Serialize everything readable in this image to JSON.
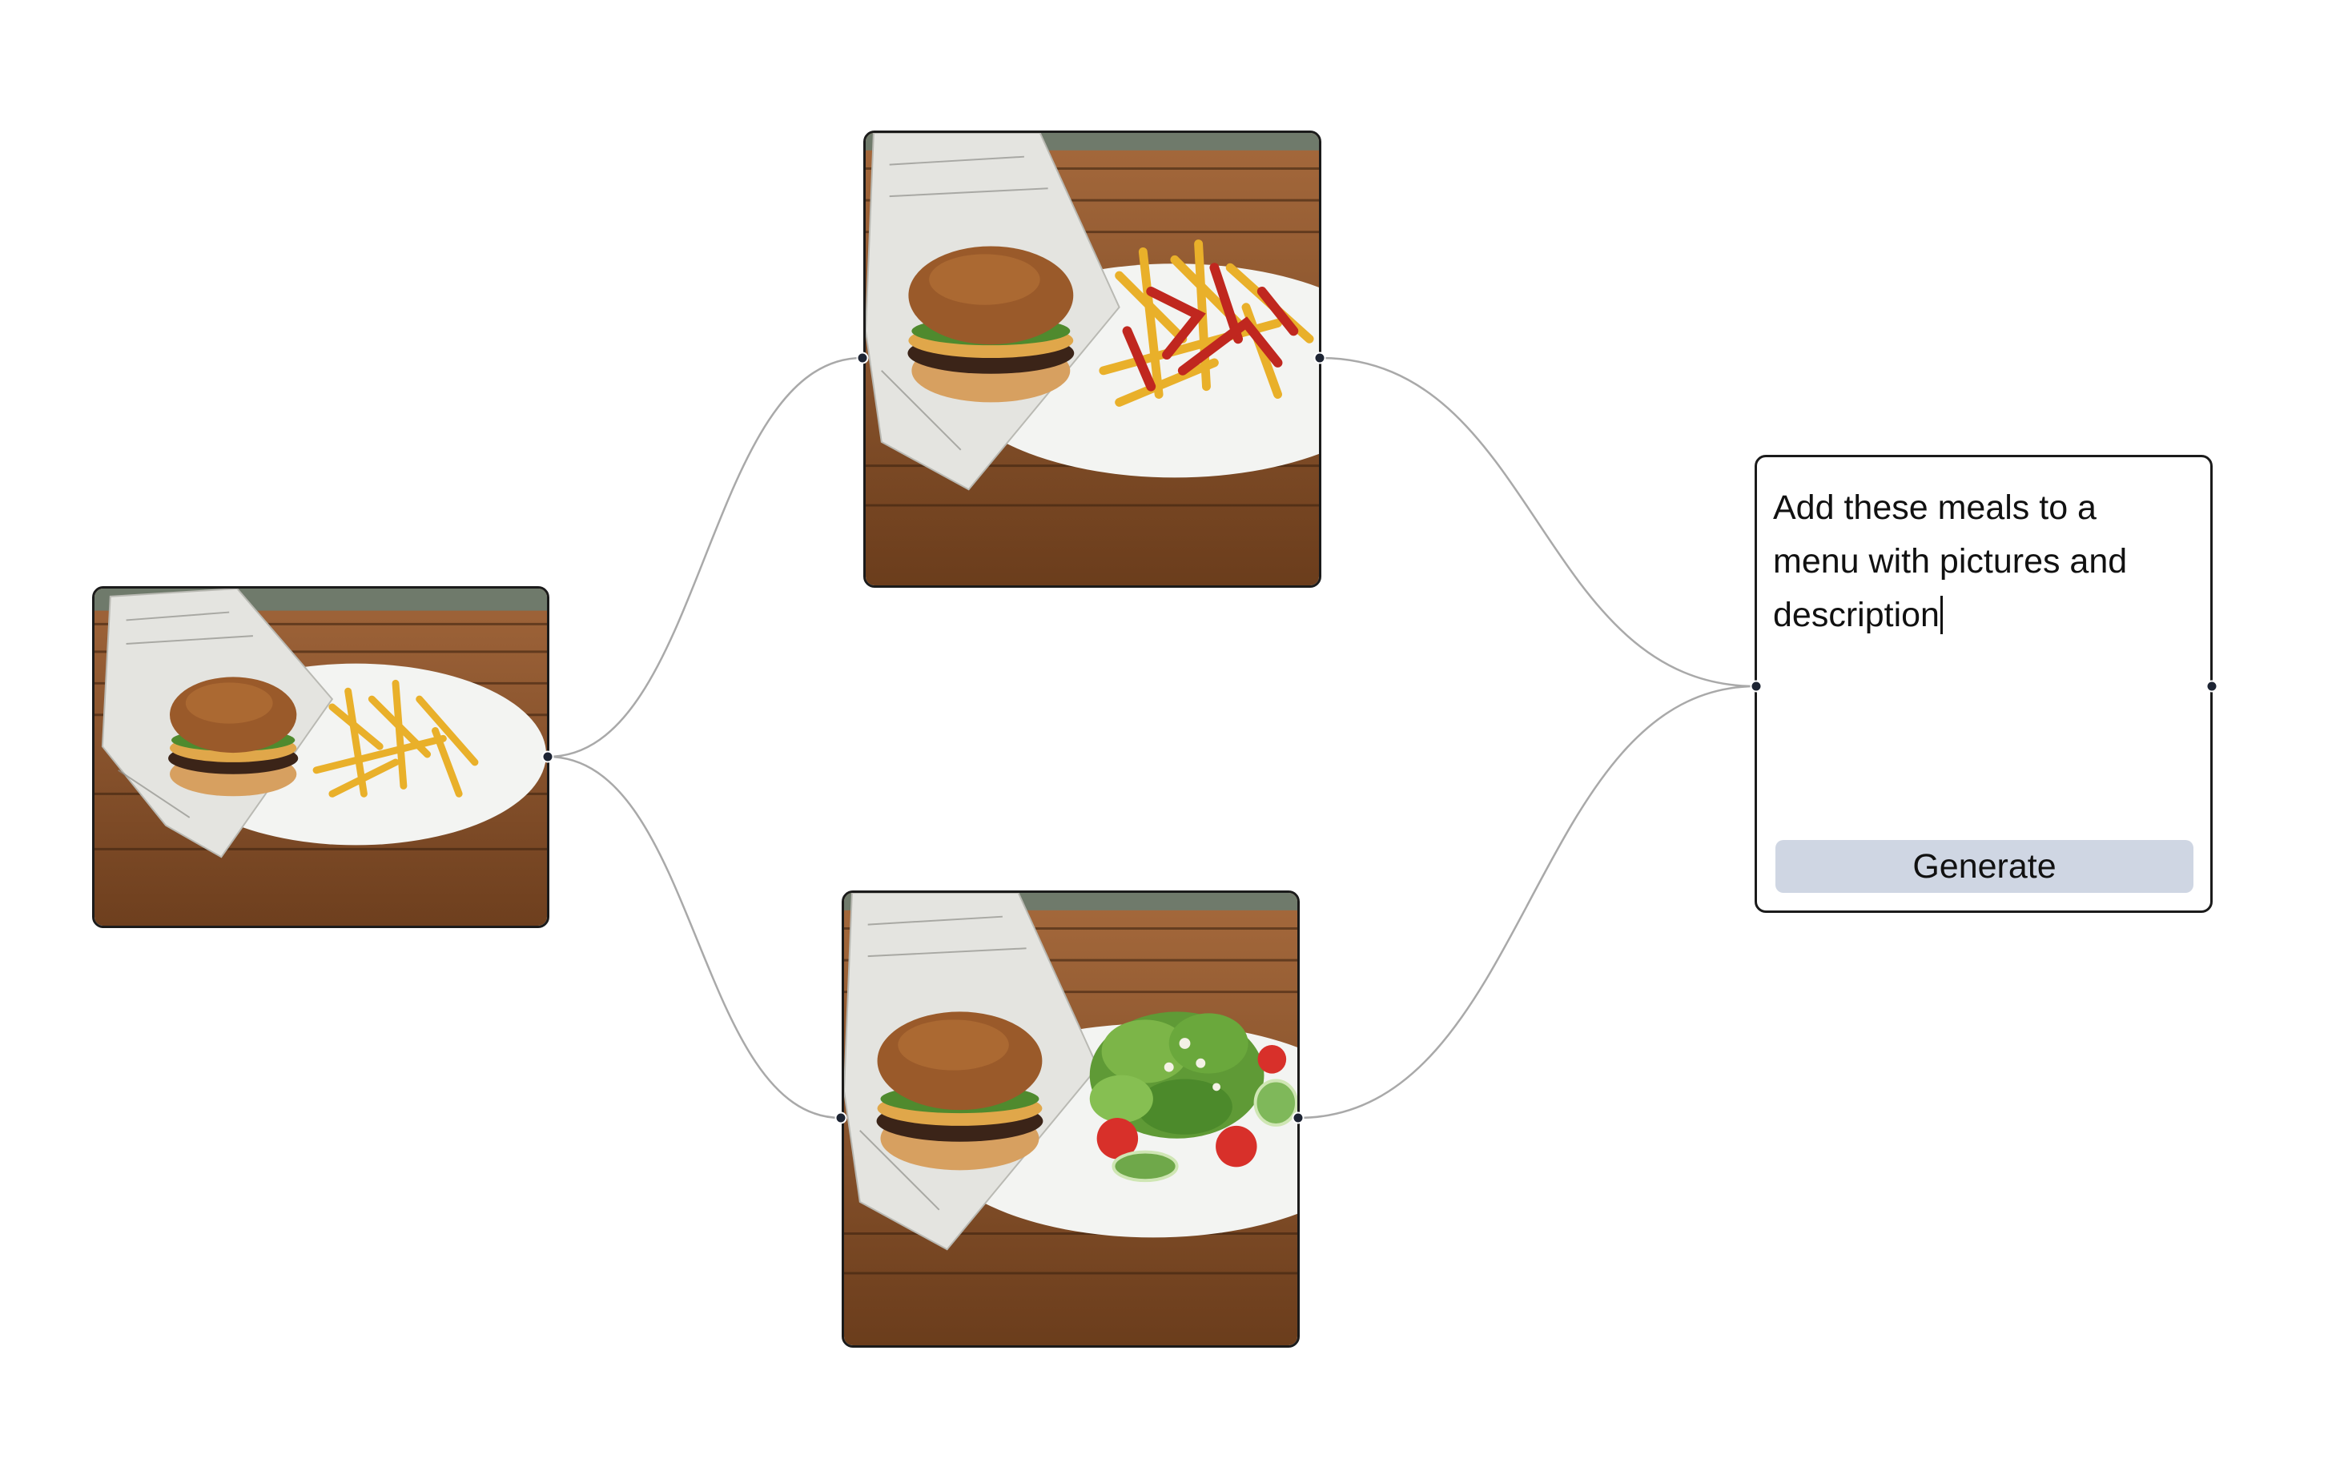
{
  "canvas": {
    "background": "#ffffff",
    "edge_color": "#a9a9a9",
    "handle_color": "#1d2433"
  },
  "image_nodes": [
    {
      "name": "source-image-burger-fries",
      "subject": "burger with fries on plate with newspaper wrap"
    },
    {
      "name": "image-burger-fries-ketchup",
      "subject": "burger with fries topped with ketchup"
    },
    {
      "name": "image-burger-salad",
      "subject": "burger with green salad, tomatoes and cucumber"
    }
  ],
  "prompt_node": {
    "text": "Add these meals to a menu with pictures and description",
    "generate_label": "Generate",
    "button_color": "#cfd6e3"
  },
  "icons": {
    "text_caret": "text-caret-icon"
  }
}
